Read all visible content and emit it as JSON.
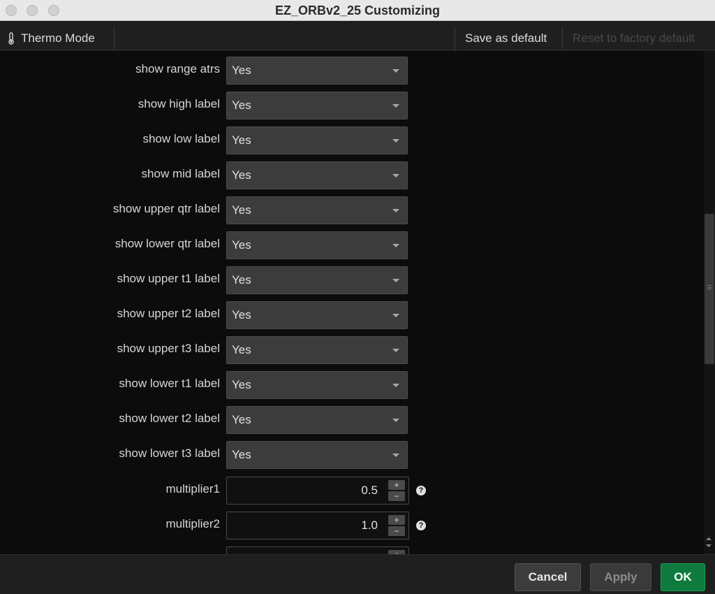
{
  "window": {
    "title": "EZ_ORBv2_25 Customizing"
  },
  "toolbar": {
    "thermo_mode": "Thermo Mode",
    "thermo_icon": "thermometer-icon",
    "save_default": "Save as default",
    "reset_default": "Reset to factory default"
  },
  "settings": [
    {
      "label": "show range atrs",
      "value": "Yes"
    },
    {
      "label": "show high label",
      "value": "Yes"
    },
    {
      "label": "show low label",
      "value": "Yes"
    },
    {
      "label": "show mid label",
      "value": "Yes"
    },
    {
      "label": "show upper qtr label",
      "value": "Yes"
    },
    {
      "label": "show lower qtr label",
      "value": "Yes"
    },
    {
      "label": "show upper t1 label",
      "value": "Yes"
    },
    {
      "label": "show upper t2 label",
      "value": "Yes"
    },
    {
      "label": "show upper t3 label",
      "value": "Yes"
    },
    {
      "label": "show lower t1 label",
      "value": "Yes"
    },
    {
      "label": "show lower t2 label",
      "value": "Yes"
    },
    {
      "label": "show lower t3 label",
      "value": "Yes"
    }
  ],
  "numeric_settings": [
    {
      "label": "multiplier1",
      "value": "0.5",
      "help": "?"
    },
    {
      "label": "multiplier2",
      "value": "1.0",
      "help": "?"
    }
  ],
  "stepper": {
    "plus": "+",
    "minus": "−"
  },
  "footer": {
    "cancel": "Cancel",
    "apply": "Apply",
    "ok": "OK"
  },
  "colors": {
    "ok_button": "#0e7a3e",
    "background": "#0c0c0c",
    "dropdown": "#3c3c3c"
  }
}
